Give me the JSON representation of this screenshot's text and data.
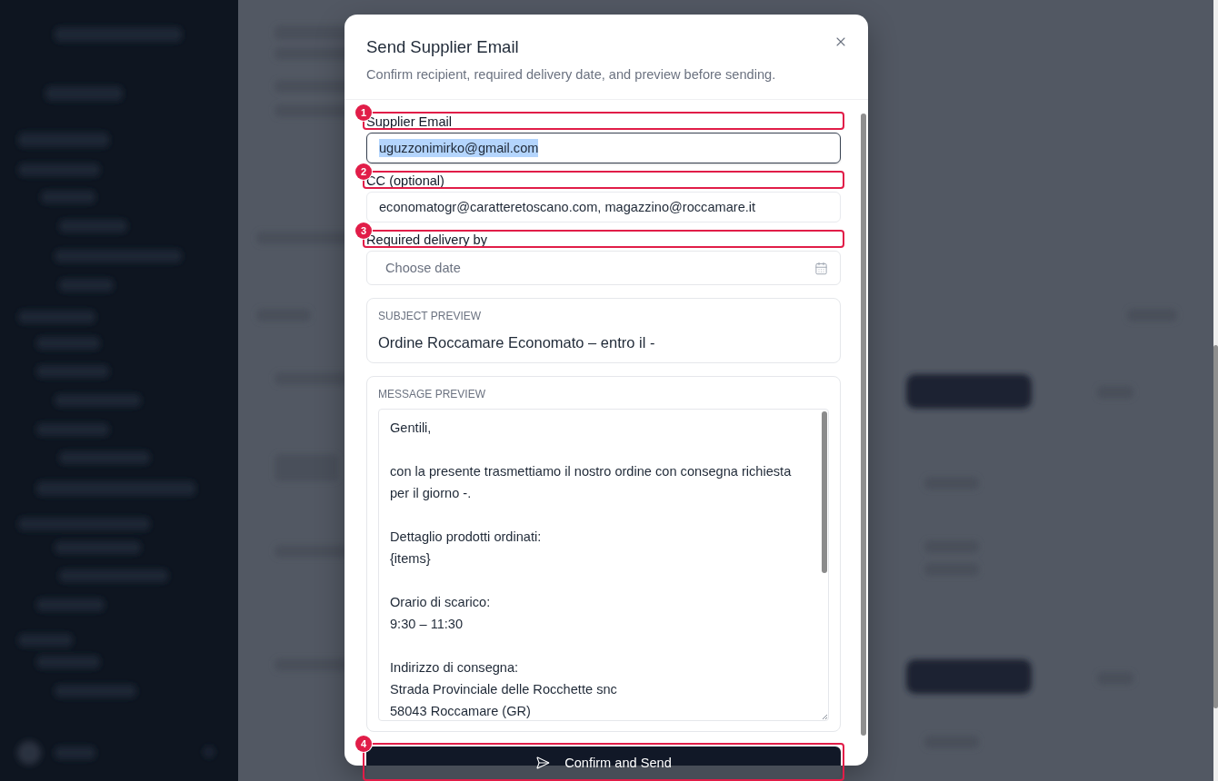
{
  "dialog": {
    "title": "Send Supplier Email",
    "subtitle": "Confirm recipient, required delivery date, and preview before sending."
  },
  "fields": [
    {
      "kind": "text",
      "label": "Supplier Email",
      "value": "uguzzonimirko@gmail.com",
      "focused": true,
      "text_selected": true,
      "annotation": "1"
    },
    {
      "kind": "text",
      "label": "CC (optional)",
      "value": "economatogr@caratteretoscano.com, magazzino@roccamare.it",
      "focused": false,
      "text_selected": false,
      "annotation": "2"
    },
    {
      "kind": "date",
      "label": "Required delivery by",
      "placeholder": "Choose date",
      "focused": false,
      "annotation": "3"
    }
  ],
  "subject_preview": {
    "label": "SUBJECT PREVIEW",
    "text": "Ordine Roccamare Economato – entro il -"
  },
  "message_preview": {
    "label": "MESSAGE PREVIEW",
    "value": "Gentili,\n\ncon la presente trasmettiamo il nostro ordine con consegna richiesta per il giorno -.\n\nDettaglio prodotti ordinati:\n{items}\n\nOrario di scarico:\n9:30 – 11:30\n\nIndirizzo di consegna:\nStrada Provinciale delle Rocchette snc\n58043 Roccamare (GR)"
  },
  "confirm_button": {
    "label": "Confirm and Send",
    "annotation": "4"
  }
}
